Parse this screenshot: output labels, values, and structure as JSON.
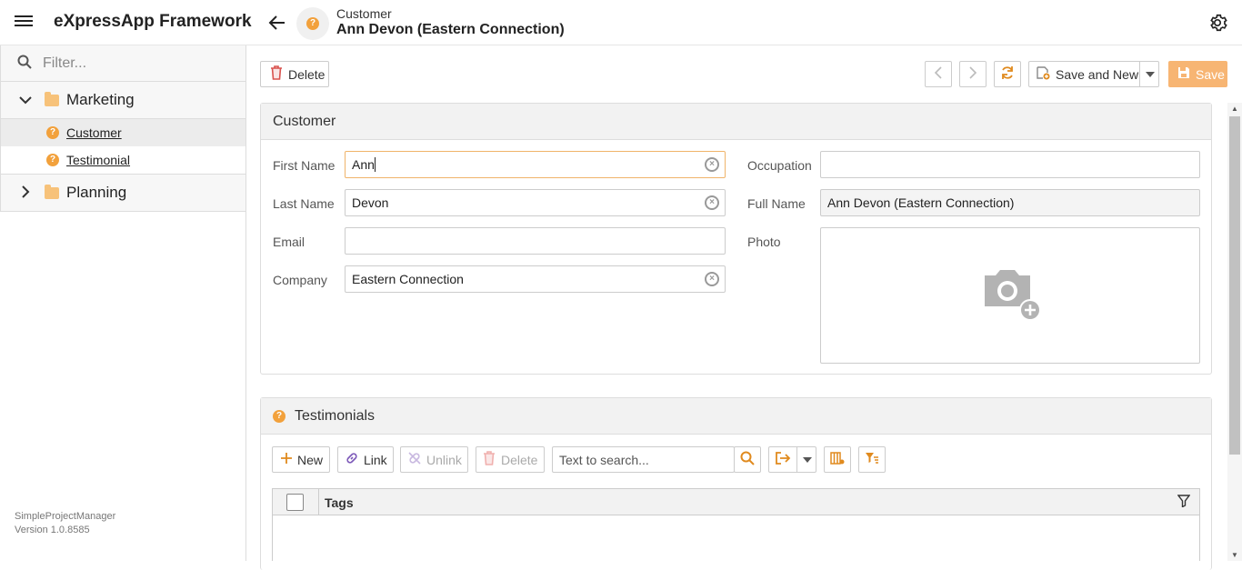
{
  "app": {
    "title": "eXpressApp Framework"
  },
  "view": {
    "subtitle": "Customer",
    "title": "Ann Devon (Eastern Connection)"
  },
  "sidebar": {
    "filter_placeholder": "Filter...",
    "groups": [
      {
        "label": "Marketing",
        "items": [
          {
            "label": "Customer"
          },
          {
            "label": "Testimonial"
          }
        ]
      },
      {
        "label": "Planning"
      }
    ],
    "footer": {
      "app_name": "SimpleProjectManager",
      "version": "Version 1.0.8585"
    }
  },
  "toolbar": {
    "delete_label": "Delete",
    "save_and_new_label": "Save and New",
    "save_label": "Save"
  },
  "customer": {
    "header": "Customer",
    "labels": {
      "first_name": "First Name",
      "last_name": "Last Name",
      "email": "Email",
      "company": "Company",
      "occupation": "Occupation",
      "full_name": "Full Name",
      "photo": "Photo"
    },
    "values": {
      "first_name": "Ann",
      "last_name": "Devon",
      "email": "",
      "company": "Eastern Connection",
      "occupation": "",
      "full_name": "Ann Devon (Eastern Connection)"
    }
  },
  "testimonials": {
    "header": "Testimonials",
    "toolbar": {
      "new": "New",
      "link": "Link",
      "unlink": "Unlink",
      "delete": "Delete",
      "search_placeholder": "Text to search..."
    },
    "columns": [
      "Tags"
    ]
  },
  "colors": {
    "accent": "#f2a13c",
    "save_button": "#f7b573"
  }
}
